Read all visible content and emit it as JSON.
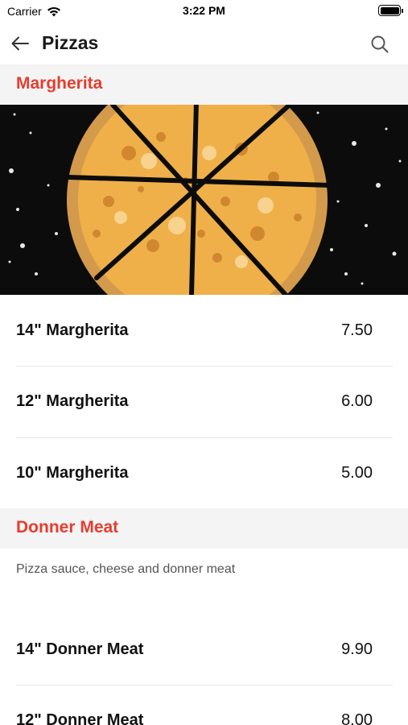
{
  "status_bar": {
    "carrier": "Carrier",
    "time": "3:22 PM"
  },
  "nav": {
    "title": "Pizzas",
    "back_icon": "arrow-left-icon",
    "search_icon": "search-icon"
  },
  "colors": {
    "accent": "#e53d2f",
    "section_bg": "#f4f4f4",
    "divider": "#e6e6e6"
  },
  "sections": [
    {
      "title": "Margherita",
      "description": "",
      "items": [
        {
          "name": "14\" Margherita",
          "price": "7.50"
        },
        {
          "name": "12\" Margherita",
          "price": "6.00"
        },
        {
          "name": "10\" Margherita",
          "price": "5.00"
        }
      ]
    },
    {
      "title": "Donner Meat",
      "description": "Pizza sauce, cheese and donner meat",
      "items": [
        {
          "name": "14\" Donner Meat",
          "price": "9.90"
        },
        {
          "name": "12\" Donner Meat",
          "price": "8.00"
        }
      ]
    }
  ]
}
